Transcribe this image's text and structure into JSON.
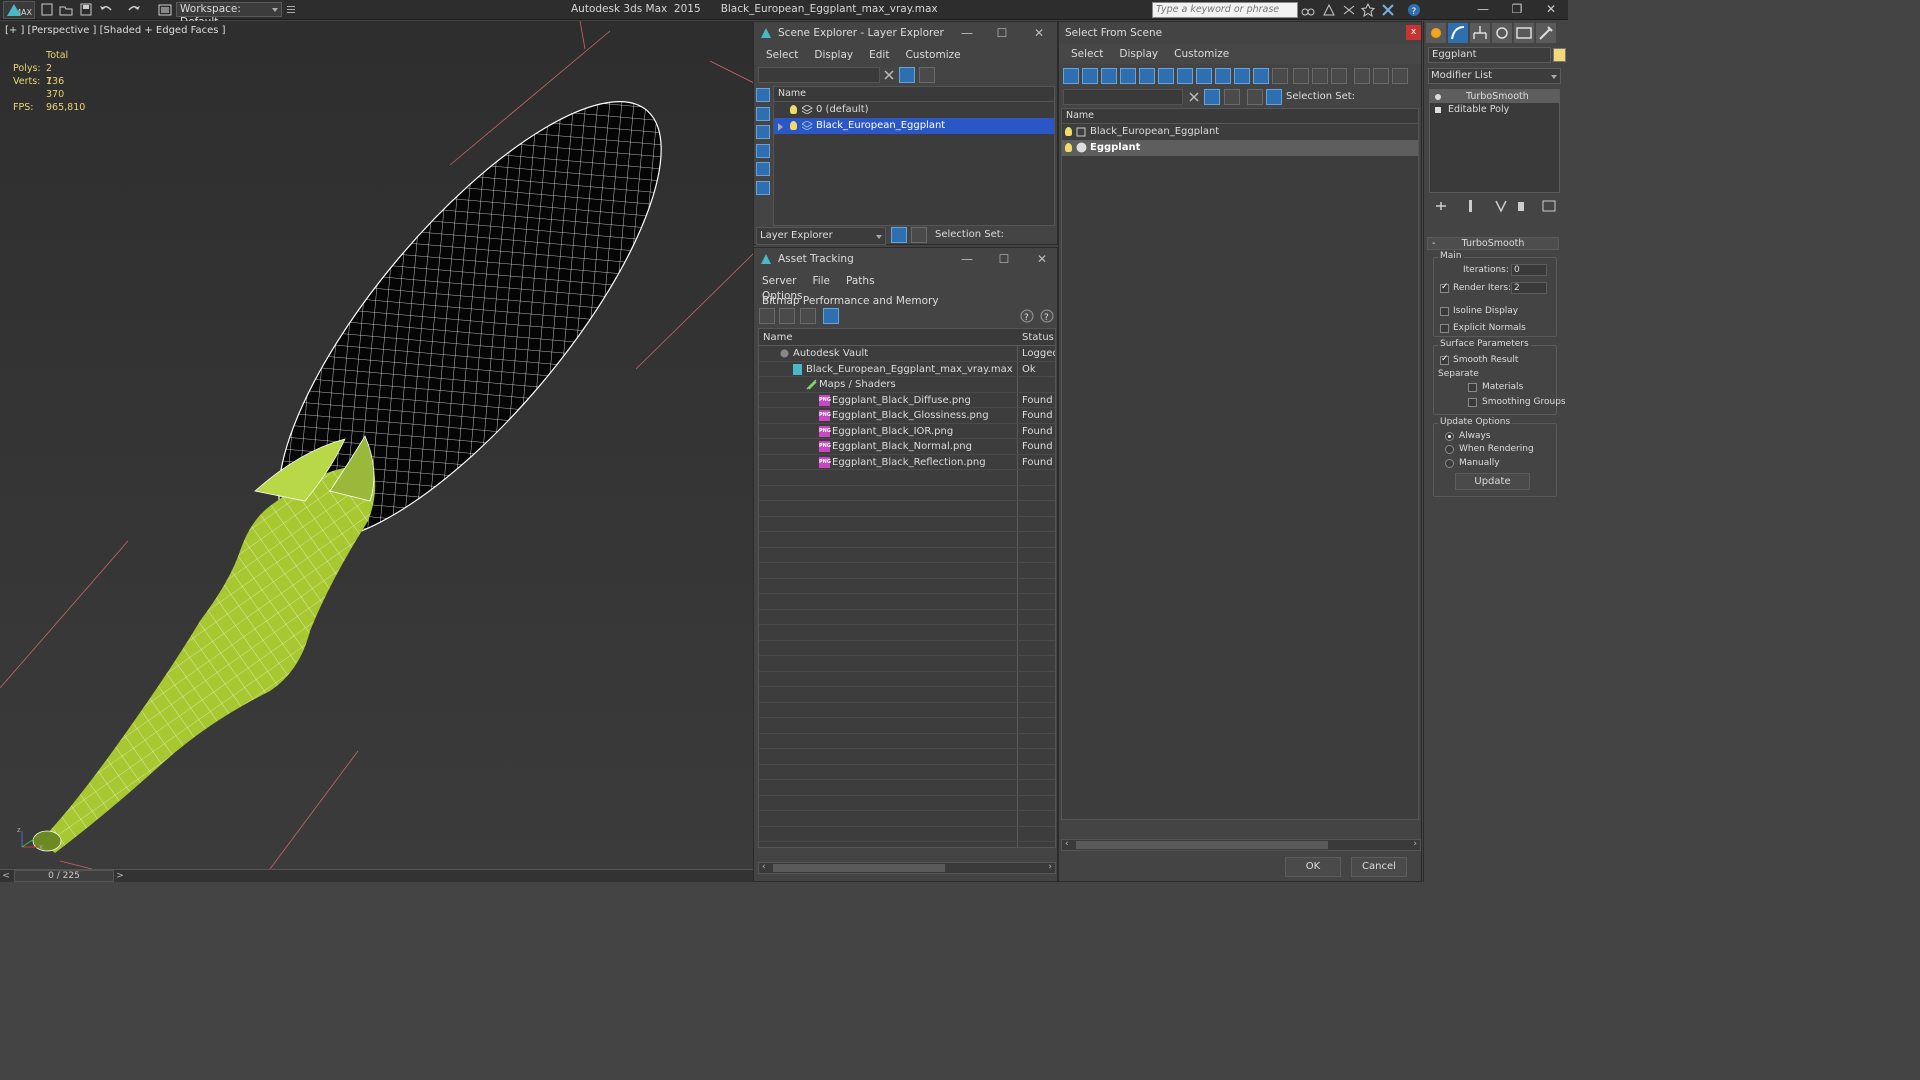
{
  "titlebar": {
    "logo_text": "MAX",
    "workspace": "Workspace: Default",
    "app": "Autodesk 3ds Max  2015",
    "file": "Black_European_Eggplant_max_vray.max",
    "search_placeholder": "Type a keyword or phrase"
  },
  "viewport": {
    "label": "[+ ] [Perspective ] [Shaded + Edged Faces ]",
    "stats": {
      "total": "Total",
      "polys_k": "Polys:",
      "polys_v": "2 736",
      "verts_k": "Verts:",
      "verts_v": "1 370",
      "fps_k": "FPS:",
      "fps_v": "965,810"
    },
    "axes": {
      "z": "z",
      "x": "x"
    }
  },
  "timeline": {
    "frame": "0 / 225",
    "prev": "<",
    "next": ">"
  },
  "scene_explorer": {
    "title": "Scene Explorer - Layer Explorer",
    "menu": [
      "Select",
      "Display",
      "Edit",
      "Customize"
    ],
    "column_name": "Name",
    "rows": [
      "0 (default)",
      "Black_European_Eggplant"
    ],
    "footer_dropdown": "Layer Explorer",
    "selection_set": "Selection Set:"
  },
  "asset_tracking": {
    "title": "Asset Tracking",
    "menu": [
      "Server",
      "File",
      "Paths",
      "Bitmap Performance and Memory",
      "Options"
    ],
    "col_name": "Name",
    "col_status": "Status",
    "rows": [
      {
        "name": "Autodesk Vault",
        "status": "Logged",
        "indent": 0
      },
      {
        "name": "Black_European_Eggplant_max_vray.max",
        "status": "Ok",
        "indent": 1
      },
      {
        "name": "Maps / Shaders",
        "status": "",
        "indent": 2
      },
      {
        "name": "Eggplant_Black_Diffuse.png",
        "status": "Found",
        "indent": 3
      },
      {
        "name": "Eggplant_Black_Glossiness.png",
        "status": "Found",
        "indent": 3
      },
      {
        "name": "Eggplant_Black_IOR.png",
        "status": "Found",
        "indent": 3
      },
      {
        "name": "Eggplant_Black_Normal.png",
        "status": "Found",
        "indent": 3
      },
      {
        "name": "Eggplant_Black_Reflection.png",
        "status": "Found",
        "indent": 3
      }
    ],
    "png_label": "PNG"
  },
  "select_from_scene": {
    "title": "Select From Scene",
    "menu": [
      "Select",
      "Display",
      "Customize"
    ],
    "selection_set": "Selection Set:",
    "column_name": "Name",
    "rows": [
      "Black_European_Eggplant",
      "Eggplant"
    ],
    "ok": "OK",
    "cancel": "Cancel",
    "close": "x"
  },
  "command_panel": {
    "object_name": "Eggplant",
    "modifier_list": "Modifier List",
    "stack": [
      "TurboSmooth",
      "Editable Poly"
    ],
    "rollout": "TurboSmooth",
    "main": "Main",
    "iterations_label": "Iterations:",
    "iterations_value": "0",
    "render_iters_label": "Render Iters:",
    "render_iters_value": "2",
    "render_iters_checked": true,
    "isoline_display": "Isoline Display",
    "explicit_normals": "Explicit Normals",
    "surface_parameters": "Surface Parameters",
    "smooth_result": "Smooth Result",
    "separate": "Separate",
    "materials": "Materials",
    "smoothing_groups": "Smoothing Groups",
    "update_options": "Update Options",
    "always": "Always",
    "when_rendering": "When Rendering",
    "manually": "Manually",
    "update_button": "Update",
    "collapse": "-"
  },
  "colors": {
    "selection_blue": "#2a57c5",
    "eggplant_green": "#a8c832",
    "light_yellow": "#f0dc6a",
    "png_magenta": "#c947c2"
  }
}
